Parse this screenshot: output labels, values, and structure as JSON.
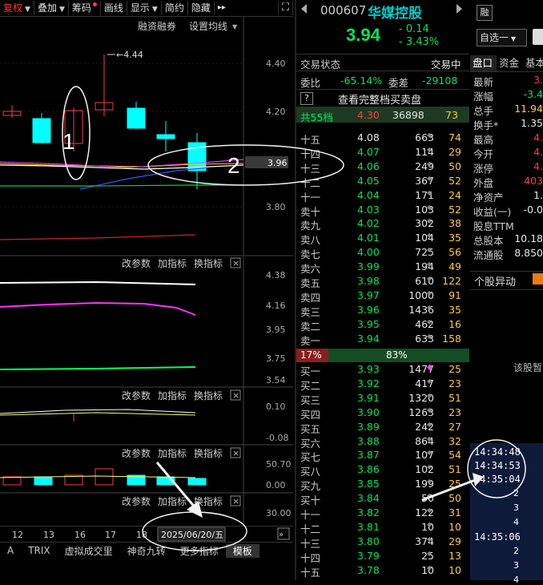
{
  "toolbar": {
    "items": [
      {
        "label": "复权",
        "arrow": true,
        "red": true,
        "dot": false
      },
      {
        "label": "叠加",
        "arrow": true,
        "red": false,
        "dot": false
      },
      {
        "label": "筹码",
        "arrow": false,
        "red": false,
        "dot": true
      },
      {
        "label": "画线",
        "arrow": false,
        "red": false,
        "dot": false
      },
      {
        "label": "显示",
        "arrow": true,
        "red": false,
        "dot": false
      },
      {
        "label": "简约",
        "arrow": false,
        "red": false,
        "dot": false
      },
      {
        "label": "隐藏",
        "arrow": false,
        "red": false,
        "dot": false
      }
    ],
    "more_glyph": "▸▸",
    "fullscreen_glyph": "⛶"
  },
  "main_panel": {
    "links": [
      "融资融券",
      "设置均线"
    ],
    "annotation_price": "4.44",
    "y_ticks": [
      "4.40",
      "4.20",
      "3.96",
      "3.80"
    ],
    "markers": [
      "1",
      "2"
    ]
  },
  "indicator_panels": [
    {
      "controls": [
        "改参数",
        "加指标",
        "换指标"
      ],
      "y_ticks": [
        "4.38",
        "4.16",
        "3.95",
        "3.75",
        "3.54"
      ]
    },
    {
      "controls": [
        "改参数",
        "加指标",
        "换指标"
      ],
      "y_ticks": [
        "0.10",
        "-0.08"
      ]
    },
    {
      "controls": [
        "改参数",
        "加指标",
        "换指标"
      ],
      "y_ticks": [
        "50.70",
        "0.00"
      ]
    },
    {
      "controls": [
        "改参数",
        "加指标",
        "换指标"
      ],
      "y_ticks": [
        "30.00"
      ]
    }
  ],
  "date_axis": {
    "labels": [
      "12",
      "13",
      "16",
      "17",
      "18"
    ],
    "current_date": "2025/06/20/五"
  },
  "bottom_tabs": [
    "A",
    "TRIX",
    "虚拟成交里",
    "神奇九转",
    "更多指标",
    "模板"
  ],
  "quote": {
    "code": "000607",
    "name": "华媒控股",
    "margin_badge": "融",
    "price": "3.94",
    "change": "- 0.14",
    "change_pct": "- 3.43%",
    "watchlist_button": "自选一",
    "status_label": "交易状态",
    "status_value": "交易中",
    "ratio_label": "委比",
    "ratio_value": "-65.14%",
    "diff_label": "委差",
    "diff_value": "-29108",
    "full_book_link": "查看完整档买卖盘",
    "levels_label": "共55档",
    "levels_price": "4.30",
    "levels_volume": "36898",
    "levels_count": "73",
    "sell_pct": "17%",
    "buy_pct": "83%"
  },
  "asks": [
    {
      "label": "十五",
      "price": "4.08",
      "volume": "663",
      "count": "74"
    },
    {
      "label": "十四",
      "price": "4.07",
      "volume": "114",
      "count": "29"
    },
    {
      "label": "十三",
      "price": "4.06",
      "volume": "249",
      "count": "50"
    },
    {
      "label": "十二",
      "price": "4.05",
      "volume": "367",
      "count": "52"
    },
    {
      "label": "十一",
      "price": "4.04",
      "volume": "171",
      "count": "24"
    },
    {
      "label": "卖十",
      "price": "4.03",
      "volume": "103",
      "count": "52"
    },
    {
      "label": "卖九",
      "price": "4.02",
      "volume": "302",
      "count": "38"
    },
    {
      "label": "卖八",
      "price": "4.01",
      "volume": "104",
      "count": "35"
    },
    {
      "label": "卖七",
      "price": "4.00",
      "volume": "725",
      "count": "56"
    },
    {
      "label": "卖六",
      "price": "3.99",
      "volume": "194",
      "count": "49"
    },
    {
      "label": "卖五",
      "price": "3.98",
      "volume": "610",
      "count": "122"
    },
    {
      "label": "卖四",
      "price": "3.97",
      "volume": "1000",
      "count": "91"
    },
    {
      "label": "卖三",
      "price": "3.96",
      "volume": "1436",
      "count": "35"
    },
    {
      "label": "卖二",
      "price": "3.95",
      "volume": "462",
      "count": "16"
    },
    {
      "label": "卖一",
      "price": "3.94",
      "volume": "633",
      "count": "158"
    }
  ],
  "bids": [
    {
      "label": "买一",
      "price": "3.93",
      "volume": "1477",
      "count": "25"
    },
    {
      "label": "买二",
      "price": "3.92",
      "volume": "417",
      "count": "23"
    },
    {
      "label": "买三",
      "price": "3.91",
      "volume": "1320",
      "count": "51"
    },
    {
      "label": "买四",
      "price": "3.90",
      "volume": "1263",
      "count": "23"
    },
    {
      "label": "买五",
      "price": "3.89",
      "volume": "242",
      "count": "27"
    },
    {
      "label": "买六",
      "price": "3.88",
      "volume": "864",
      "count": "32"
    },
    {
      "label": "买七",
      "price": "3.87",
      "volume": "107",
      "count": "54"
    },
    {
      "label": "买八",
      "price": "3.86",
      "volume": "102",
      "count": "51"
    },
    {
      "label": "买九",
      "price": "3.85",
      "volume": "199",
      "count": "25"
    },
    {
      "label": "买十",
      "price": "3.84",
      "volume": "50",
      "count": "50"
    },
    {
      "label": "十一",
      "price": "3.82",
      "volume": "122",
      "count": "31"
    },
    {
      "label": "十二",
      "price": "3.81",
      "volume": "10",
      "count": "10"
    },
    {
      "label": "十三",
      "price": "3.80",
      "volume": "374",
      "count": "29"
    },
    {
      "label": "十四",
      "price": "3.79",
      "volume": "25",
      "count": "13"
    },
    {
      "label": "十五",
      "price": "3.78",
      "volume": "10",
      "count": "10"
    }
  ],
  "side_panel": {
    "tabs": [
      "盘口",
      "资金",
      "基本"
    ],
    "stats": [
      {
        "label": "最新",
        "value": "3."
      },
      {
        "label": "涨幅",
        "value": "-3.4"
      },
      {
        "label": "总手",
        "value": "11.94"
      },
      {
        "label": "换手*",
        "value": "1.35"
      },
      {
        "label": "最高",
        "value": "4."
      },
      {
        "label": "今开",
        "value": "4."
      },
      {
        "label": "涨停",
        "value": "4."
      },
      {
        "label": "外盘",
        "value": "403"
      },
      {
        "label": "净资产",
        "value": "1."
      },
      {
        "label": "收益(一)",
        "value": "-0.0"
      },
      {
        "label": "股息TTM",
        "value": ""
      },
      {
        "label": "总股本",
        "value": "10.18"
      },
      {
        "label": "流通股",
        "value": "8.850"
      }
    ],
    "anomaly_title": "个股异动",
    "anomaly_placeholder": "该股暂",
    "times": [
      "14:34:48",
      "14:34:53",
      "14:35:04",
      "14:35:06"
    ],
    "counts_a": [
      "2",
      "3",
      "4"
    ],
    "counts_b": [
      "2",
      "3",
      "4",
      "5"
    ]
  }
}
